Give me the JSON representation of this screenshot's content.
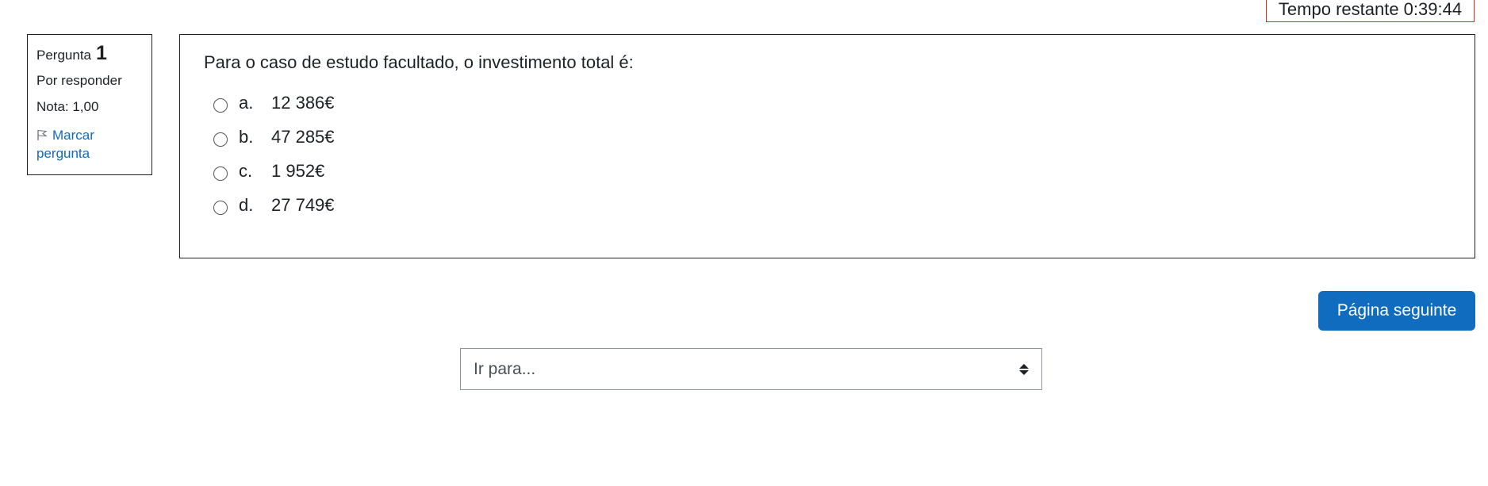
{
  "timer": {
    "text": "Tempo restante 0:39:44"
  },
  "question_info": {
    "label": "Pergunta",
    "number": "1",
    "state": "Por responder",
    "grade": "Nota: 1,00",
    "flag_label": "Marcar pergunta",
    "icon": "flag-icon"
  },
  "question": {
    "text": "Para o caso de estudo facultado, o investimento total é:",
    "answers": [
      {
        "letter": "a.",
        "text": "12 386€"
      },
      {
        "letter": "b.",
        "text": "47 285€"
      },
      {
        "letter": "c.",
        "text": "1 952€"
      },
      {
        "letter": "d.",
        "text": "27 749€"
      }
    ]
  },
  "navigation": {
    "next_label": "Página seguinte",
    "jump_placeholder": "Ir para...",
    "jump_icon": "updown-arrows-icon"
  },
  "colors": {
    "accent": "#0f6cbf",
    "timer_border": "#ca3120"
  }
}
